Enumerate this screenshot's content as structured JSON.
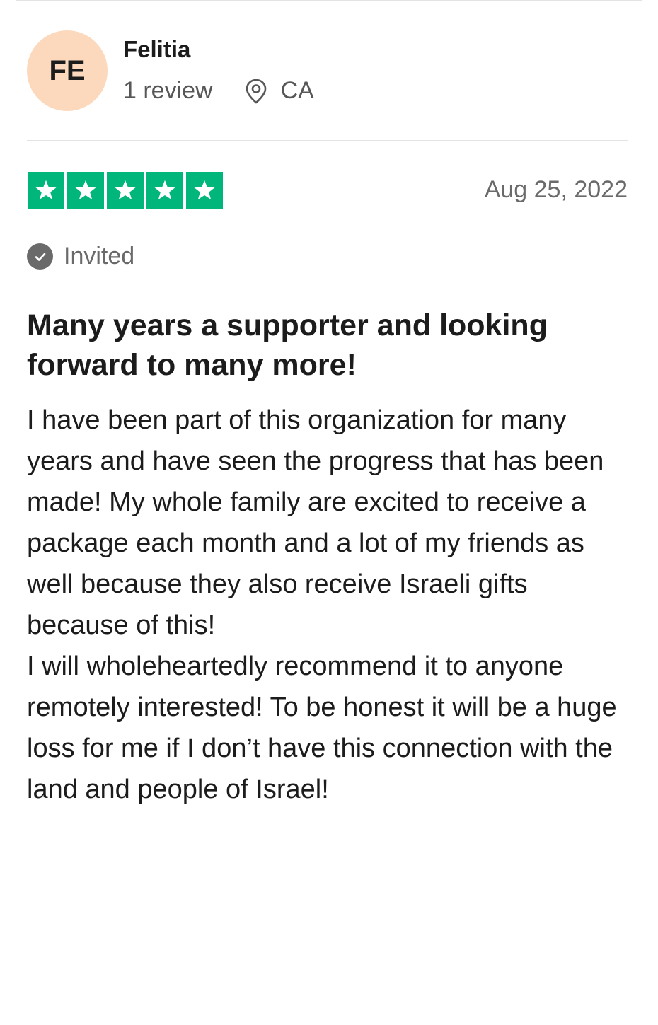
{
  "reviewer": {
    "initials": "FE",
    "name": "Felitia",
    "review_count": "1 review",
    "location": "CA"
  },
  "review": {
    "rating": 5,
    "rating_max": 5,
    "date": "Aug 25, 2022",
    "badge": "Invited",
    "title": "Many years a supporter and looking forward to many more!",
    "body": [
      "I have been part of this organization for many years and have seen the progress that has been made! My whole family are excited to receive a package each month and a lot of my friends as well because they also receive Israeli gifts because of this!",
      "I will wholeheartedly recommend it to anyone remotely interested! To be honest it will be a huge loss for me if I don’t have this connection with the land and people of Israel!"
    ]
  },
  "colors": {
    "star_green": "#00b67a",
    "avatar_bg": "#fcd9bd"
  },
  "icons": [
    "location-pin-icon",
    "star-icon",
    "checkmark-icon"
  ]
}
